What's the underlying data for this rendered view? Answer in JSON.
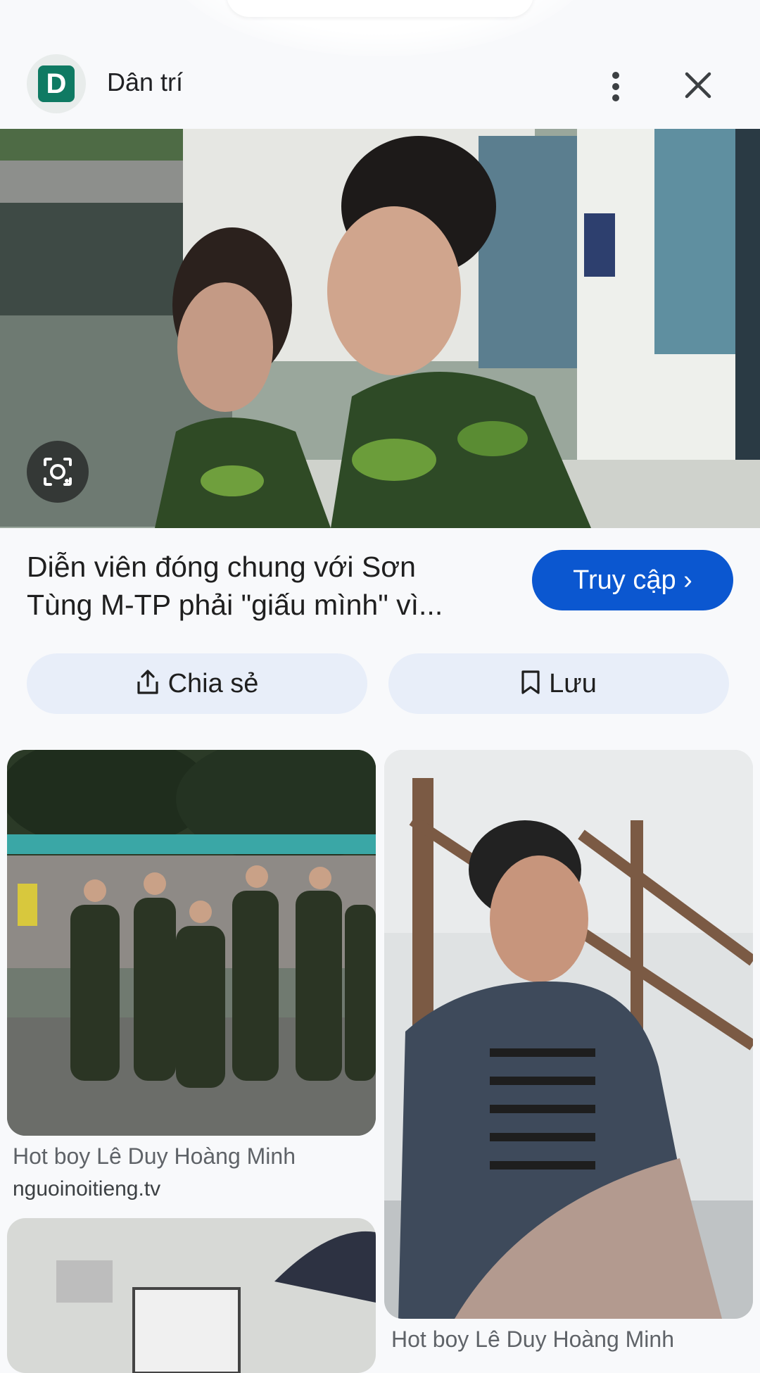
{
  "header": {
    "site_logo_letter": "D",
    "site_name": "Dân trí"
  },
  "article": {
    "title": "Diễn viên đóng chung với Sơn\nTùng M-TP phải \"giấu mình\" vì...",
    "visit_label": "Truy cập ›"
  },
  "actions": {
    "share_label": "Chia sẻ",
    "save_label": "Lưu"
  },
  "results": [
    {
      "caption": "Hot boy Lê Duy Hoàng Minh",
      "source": "nguoinoitieng.tv"
    },
    {
      "caption": "Hot boy Lê Duy Hoàng Minh"
    }
  ],
  "colors": {
    "accent": "#0b57d0",
    "button_bg": "#e8eef9",
    "logo": "#0f7a63"
  },
  "icons": [
    "more-vert-icon",
    "close-icon",
    "lens-icon",
    "share-icon",
    "bookmark-icon"
  ]
}
